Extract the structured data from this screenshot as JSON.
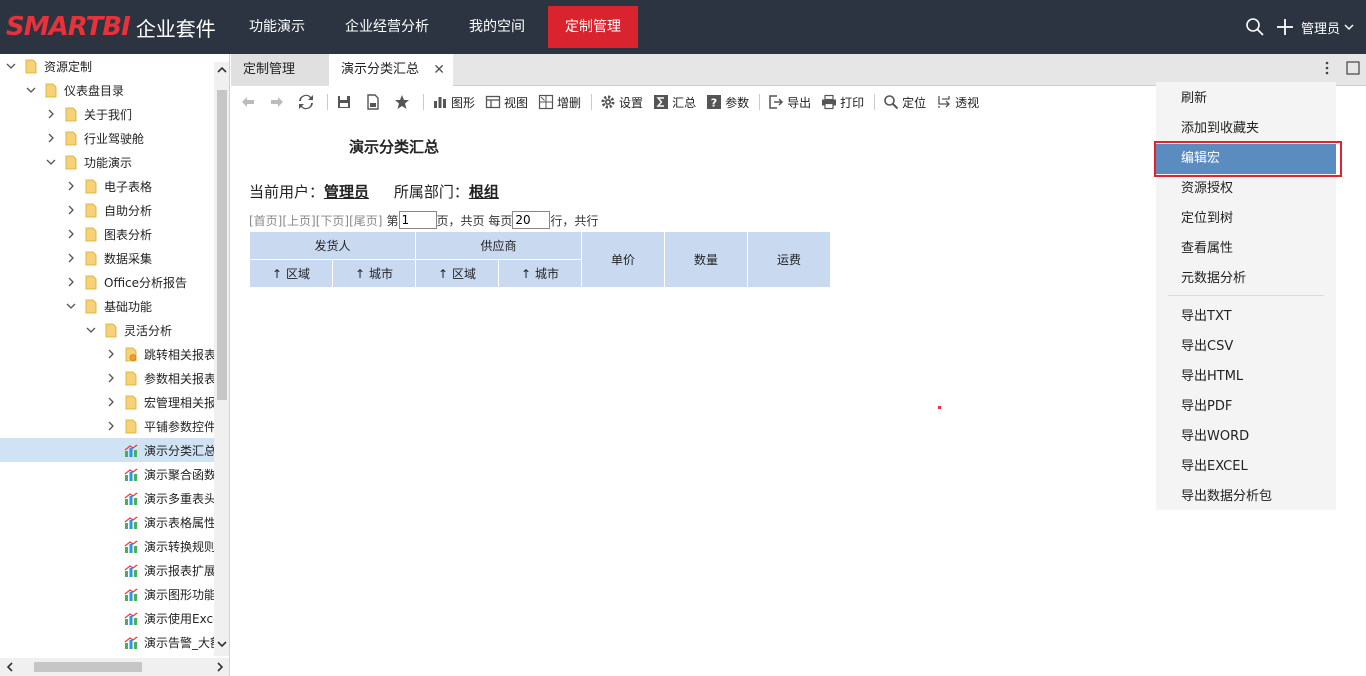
{
  "header": {
    "logo_brand": "SMARTBI",
    "logo_suite": "企业套件",
    "nav": [
      {
        "label": "功能演示",
        "active": false
      },
      {
        "label": "企业经营分析",
        "active": false
      },
      {
        "label": "我的空间",
        "active": false
      },
      {
        "label": "定制管理",
        "active": true
      }
    ],
    "user": "管理员"
  },
  "sidebar": {
    "items": [
      {
        "label": "资源定制",
        "level": 0,
        "type": "folder",
        "expanded": true
      },
      {
        "label": "仪表盘目录",
        "level": 1,
        "type": "folder",
        "expanded": true
      },
      {
        "label": "关于我们",
        "level": 2,
        "type": "folder",
        "expanded": false
      },
      {
        "label": "行业驾驶舱",
        "level": 2,
        "type": "folder",
        "expanded": false
      },
      {
        "label": "功能演示",
        "level": 2,
        "type": "folder",
        "expanded": true
      },
      {
        "label": "电子表格",
        "level": 3,
        "type": "folder",
        "expanded": false
      },
      {
        "label": "自助分析",
        "level": 3,
        "type": "folder",
        "expanded": false
      },
      {
        "label": "图表分析",
        "level": 3,
        "type": "folder",
        "expanded": false
      },
      {
        "label": "数据采集",
        "level": 3,
        "type": "folder",
        "expanded": false
      },
      {
        "label": "Office分析报告",
        "level": 3,
        "type": "folder",
        "expanded": false
      },
      {
        "label": "基础功能",
        "level": 3,
        "type": "folder",
        "expanded": true
      },
      {
        "label": "灵活分析",
        "level": 4,
        "type": "folder",
        "expanded": true
      },
      {
        "label": "跳转相关报表",
        "level": 5,
        "type": "folder-special",
        "expanded": false
      },
      {
        "label": "参数相关报表",
        "level": 5,
        "type": "folder",
        "expanded": false
      },
      {
        "label": "宏管理相关报",
        "level": 5,
        "type": "folder",
        "expanded": false
      },
      {
        "label": "平铺参数控件",
        "level": 5,
        "type": "folder",
        "expanded": false
      },
      {
        "label": "演示分类汇总",
        "level": 5,
        "type": "report",
        "selected": true
      },
      {
        "label": "演示聚合函数",
        "level": 5,
        "type": "report"
      },
      {
        "label": "演示多重表头",
        "level": 5,
        "type": "report"
      },
      {
        "label": "演示表格属性",
        "level": 5,
        "type": "report"
      },
      {
        "label": "演示转换规则",
        "level": 5,
        "type": "report"
      },
      {
        "label": "演示报表扩展",
        "level": 5,
        "type": "report"
      },
      {
        "label": "演示图形功能",
        "level": 5,
        "type": "report"
      },
      {
        "label": "演示使用Exce",
        "level": 5,
        "type": "report"
      },
      {
        "label": "演示告警_大额",
        "level": 5,
        "type": "report"
      }
    ]
  },
  "tabs": [
    {
      "label": "定制管理"
    },
    {
      "label": "演示分类汇总",
      "closable": true
    }
  ],
  "toolbar": {
    "chart": "图形",
    "view": "视图",
    "insert_delete": "增删",
    "settings": "设置",
    "summary": "汇总",
    "params": "参数",
    "export": "导出",
    "print": "打印",
    "locate": "定位",
    "pivot": "透视"
  },
  "report": {
    "title": "演示分类汇总",
    "current_user_label": "当前用户：",
    "current_user": "管理员",
    "dept_label": "所属部门：",
    "dept": "根组",
    "pager": {
      "first": "[首页]",
      "prev": "[上页]",
      "next": "[下页]",
      "last": "[尾页]",
      "page_prefix": "第",
      "page_value": "1",
      "page_suffix": "页，共页 每页",
      "rows_value": "20",
      "rows_suffix": "行，共行"
    },
    "headers": {
      "shipper": "发货人",
      "supplier": "供应商",
      "region": "区域",
      "city": "城市",
      "unit_price": "单价",
      "quantity": "数量",
      "freight": "运费",
      "sort_arrow": "↑"
    }
  },
  "context_menu": {
    "items": [
      {
        "label": "刷新"
      },
      {
        "label": "添加到收藏夹"
      },
      {
        "label": "编辑宏",
        "highlighted": true
      },
      {
        "label": "资源授权"
      },
      {
        "label": "定位到树"
      },
      {
        "label": "查看属性"
      },
      {
        "label": "元数据分析"
      },
      {
        "label": "导出TXT"
      },
      {
        "label": "导出CSV"
      },
      {
        "label": "导出HTML"
      },
      {
        "label": "导出PDF"
      },
      {
        "label": "导出WORD"
      },
      {
        "label": "导出EXCEL"
      },
      {
        "label": "导出数据分析包"
      }
    ]
  },
  "colors": {
    "topbar": "#2b3440",
    "accent": "#d9242f",
    "menu_highlight": "#5b8cc0",
    "table_header": "#c9daf0"
  }
}
